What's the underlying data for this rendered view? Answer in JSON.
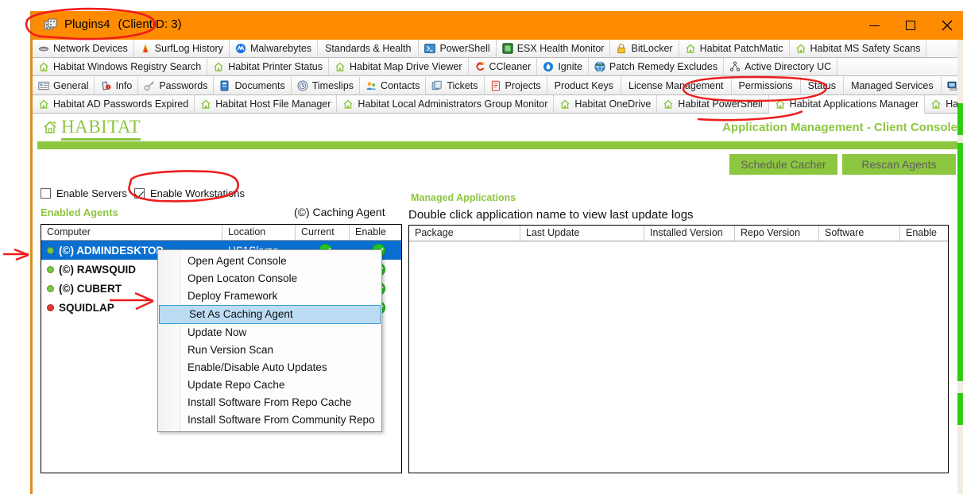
{
  "window": {
    "title": "Plugins4",
    "client_id": "(ClientID: 3)",
    "icon": "plugins-icon",
    "buttons": {
      "minimize": "minimize-icon",
      "maximize": "maximize-icon",
      "close": "close-icon"
    }
  },
  "tab_rows": [
    [
      {
        "label": "Network Devices",
        "icon": "network-devices-icon",
        "icon_kind": "device",
        "active": false
      },
      {
        "label": "SurfLog History",
        "icon": "surflog-icon",
        "icon_kind": "flame",
        "active": false
      },
      {
        "label": "Malwarebytes",
        "icon": "malwarebytes-icon",
        "icon_kind": "malwarebytes",
        "active": false
      },
      {
        "label": "Standards & Health",
        "icon": "none",
        "icon_kind": "none",
        "active": false
      },
      {
        "label": "PowerShell",
        "icon": "powershell-icon",
        "icon_kind": "powershell",
        "active": false
      },
      {
        "label": "ESX Health Monitor",
        "icon": "esx-icon",
        "icon_kind": "esx",
        "active": false
      },
      {
        "label": "BitLocker",
        "icon": "bitlocker-icon",
        "icon_kind": "lock",
        "active": false
      },
      {
        "label": "Habitat PatchMatic",
        "icon": "habitat-icon",
        "icon_kind": "house",
        "active": false
      },
      {
        "label": "Habitat MS Safety Scans",
        "icon": "habitat-icon",
        "icon_kind": "house",
        "active": false
      }
    ],
    [
      {
        "label": "Habitat Windows Registry Search",
        "icon": "habitat-icon",
        "icon_kind": "house",
        "active": false
      },
      {
        "label": "Habitat Printer Status",
        "icon": "habitat-icon",
        "icon_kind": "house",
        "active": false
      },
      {
        "label": "Habitat Map Drive Viewer",
        "icon": "habitat-icon",
        "icon_kind": "house",
        "active": false
      },
      {
        "label": "CCleaner",
        "icon": "ccleaner-icon",
        "icon_kind": "ccleaner",
        "active": false
      },
      {
        "label": "Ignite",
        "icon": "ignite-icon",
        "icon_kind": "ignite",
        "active": false
      },
      {
        "label": "Patch Remedy Excludes",
        "icon": "patch-remedy-icon",
        "icon_kind": "globe",
        "active": false
      },
      {
        "label": "Active Directory UC",
        "icon": "active-directory-icon",
        "icon_kind": "ad",
        "active": false
      }
    ],
    [
      {
        "label": "General",
        "icon": "general-icon",
        "icon_kind": "card",
        "active": false
      },
      {
        "label": "Info",
        "icon": "info-icon",
        "icon_kind": "info",
        "active": false
      },
      {
        "label": "Passwords",
        "icon": "passwords-icon",
        "icon_kind": "key",
        "active": false
      },
      {
        "label": "Documents",
        "icon": "documents-icon",
        "icon_kind": "doc",
        "active": false
      },
      {
        "label": "Timeslips",
        "icon": "timeslips-icon",
        "icon_kind": "clock",
        "active": false
      },
      {
        "label": "Contacts",
        "icon": "contacts-icon",
        "icon_kind": "contacts",
        "active": false
      },
      {
        "label": "Tickets",
        "icon": "tickets-icon",
        "icon_kind": "tickets",
        "active": false
      },
      {
        "label": "Projects",
        "icon": "projects-icon",
        "icon_kind": "projects",
        "active": false
      },
      {
        "label": "Product Keys",
        "icon": "none",
        "icon_kind": "none",
        "active": false
      },
      {
        "label": "License Management",
        "icon": "none",
        "icon_kind": "none",
        "active": false
      },
      {
        "label": "Permissions",
        "icon": "none",
        "icon_kind": "none",
        "active": false
      },
      {
        "label": "Status",
        "icon": "none",
        "icon_kind": "none",
        "active": false
      },
      {
        "label": "Managed Services",
        "icon": "none",
        "icon_kind": "none",
        "active": false
      },
      {
        "label": "Computers",
        "icon": "computers-icon",
        "icon_kind": "computer",
        "active": false
      }
    ],
    [
      {
        "label": "Habitat AD Passwords Expired",
        "icon": "habitat-icon",
        "icon_kind": "house",
        "active": false
      },
      {
        "label": "Habitat Host File Manager",
        "icon": "habitat-icon",
        "icon_kind": "house",
        "active": false
      },
      {
        "label": "Habitat Local Administrators Group Monitor",
        "icon": "habitat-icon",
        "icon_kind": "house",
        "active": false
      },
      {
        "label": "Habitat OneDrive",
        "icon": "habitat-icon",
        "icon_kind": "house",
        "active": false
      },
      {
        "label": "Habitat PowerShell",
        "icon": "habitat-icon",
        "icon_kind": "house",
        "active": false
      },
      {
        "label": "Habitat Applications Manager",
        "icon": "habitat-icon",
        "icon_kind": "house",
        "active": true
      },
      {
        "label": "Habitat Windows Backup",
        "icon": "habitat-icon",
        "icon_kind": "house",
        "active": false
      }
    ]
  ],
  "header": {
    "logo_text": "HABITAT",
    "logo_icon": "habitat-house-icon",
    "console_title": "Application Management - Client Console"
  },
  "toolbar": {
    "schedule_label": "Schedule Cacher",
    "rescan_label": "Rescan Agents"
  },
  "options": {
    "enable_servers": {
      "label": "Enable Servers",
      "checked": false
    },
    "enable_workstations": {
      "label": "Enable Workstations",
      "checked": true
    }
  },
  "labels": {
    "enabled_agents": "Enabled Agents",
    "caching_agent": "(©) Caching Agent",
    "managed_applications": "Managed Applications",
    "double_click_hint": "Double click application name to view last update logs"
  },
  "agents_table": {
    "columns": [
      "Computer",
      "Location",
      "Current",
      "Enable"
    ],
    "rows": [
      {
        "name": "(©) ADMINDESKTOP",
        "status": "green",
        "location": "US1Skype",
        "current": "check",
        "enable": "check",
        "selected": true
      },
      {
        "name": "(©) RAWSQUID",
        "status": "green",
        "location": "",
        "current": "check",
        "enable": "check",
        "selected": false
      },
      {
        "name": "(©) CUBERT",
        "status": "green",
        "location": "",
        "current": "check",
        "enable": "check",
        "selected": false
      },
      {
        "name": "SQUIDLAP",
        "status": "red",
        "location": "",
        "current": "check",
        "enable": "check",
        "selected": false
      }
    ]
  },
  "apps_table": {
    "columns": [
      "Package",
      "Last Update",
      "Installed Version",
      "Repo Version",
      "Software",
      "Enable"
    ],
    "rows": []
  },
  "context_menu": {
    "items": [
      {
        "label": "Open Agent Console",
        "highlighted": false
      },
      {
        "label": "Open Locaton Console",
        "highlighted": false
      },
      {
        "label": "Deploy Framework",
        "highlighted": false
      },
      {
        "label": "Set As Caching Agent",
        "highlighted": true
      },
      {
        "label": "Update Now",
        "highlighted": false
      },
      {
        "label": "Run Version Scan",
        "highlighted": false
      },
      {
        "label": "Enable/Disable Auto Updates",
        "highlighted": false
      },
      {
        "label": "Update Repo Cache",
        "highlighted": false
      },
      {
        "label": "Install Software From Repo Cache",
        "highlighted": false
      },
      {
        "label": "Install Software From Community Repo",
        "highlighted": false
      }
    ]
  },
  "colors": {
    "titlebar": "#ff8c00",
    "accent_green": "#8dc63f",
    "selection_blue": "#0a6fd1",
    "annotation_red": "#ee1c1c",
    "menu_highlight": "#bcdcf4"
  },
  "annotations": {
    "title_circle": "red-ellipse-around-window-title",
    "tab_circle": "red-ellipse-around-habitat-applications-manager-tab",
    "workstations_circle": "red-ellipse-around-enable-workstations",
    "title_strike": "red-line-through-application-management",
    "left_arrow": "red-arrow-pointing-at-agent-rows",
    "menu_arrow": "red-arrow-pointing-at-set-as-caching-agent"
  }
}
